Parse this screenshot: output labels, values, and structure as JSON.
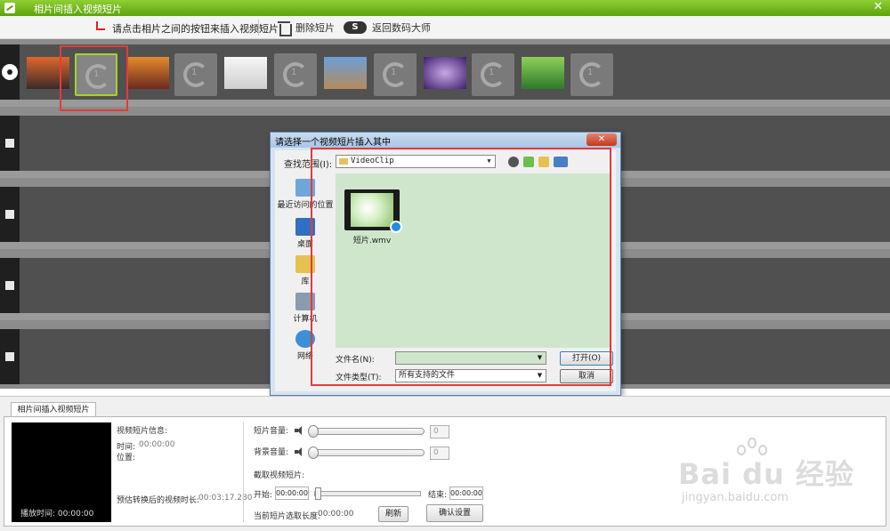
{
  "window": {
    "title": "相片间插入视频短片"
  },
  "toolbar": {
    "hint": "请点击相片之间的按钮来插入视频短片",
    "delete_label": "删除短片",
    "back_label": "返回数码大师",
    "back_logo": "S"
  },
  "filmstrip": {
    "slot_number": "1"
  },
  "dialog": {
    "title": "请选择一个视频短片插入其中",
    "close": "✕",
    "lookin_label": "查找范围(I):",
    "lookin_value": "VideoClip",
    "places": [
      {
        "label": "最近访问的位置"
      },
      {
        "label": "桌面"
      },
      {
        "label": "库"
      },
      {
        "label": "计算机"
      },
      {
        "label": "网络"
      }
    ],
    "file": {
      "name": "短片.wmv"
    },
    "filename_label": "文件名(N):",
    "filename_value": "",
    "filetype_label": "文件类型(T):",
    "filetype_value": "所有支持的文件",
    "open_button": "打开(O)",
    "cancel_button": "取消"
  },
  "panel": {
    "tab": "相片间插入视频短片",
    "play_time_label": "播放时间:",
    "play_time": "00:00:00",
    "info_title": "视频短片信息:",
    "time_label": "时间:",
    "time_value": "00:00:00",
    "position_label": "位置:",
    "estimated_label": "预估转换后的视频时长:",
    "estimated_value": "00:03:17.280",
    "clip_volume_label": "短片音量:",
    "clip_volume_value": "0",
    "bg_volume_label": "背景音量:",
    "bg_volume_value": "0",
    "trim_label": "截取视频短片:",
    "start_label": "开始:",
    "start_value": "00:00:00",
    "end_label": "结束:",
    "end_value": "00:00:00",
    "length_label": "当前短片选取长度:",
    "length_value": "00:00:00",
    "refresh_button": "刷新",
    "confirm_button": "确认设置"
  },
  "watermark": {
    "brand": "Bai du 经验",
    "url": "jingyan.baidu.com"
  },
  "colors": {
    "titlebar": "#6cb21a",
    "annotation": "#e33b3b",
    "selected_slot": "#a6d22c"
  }
}
